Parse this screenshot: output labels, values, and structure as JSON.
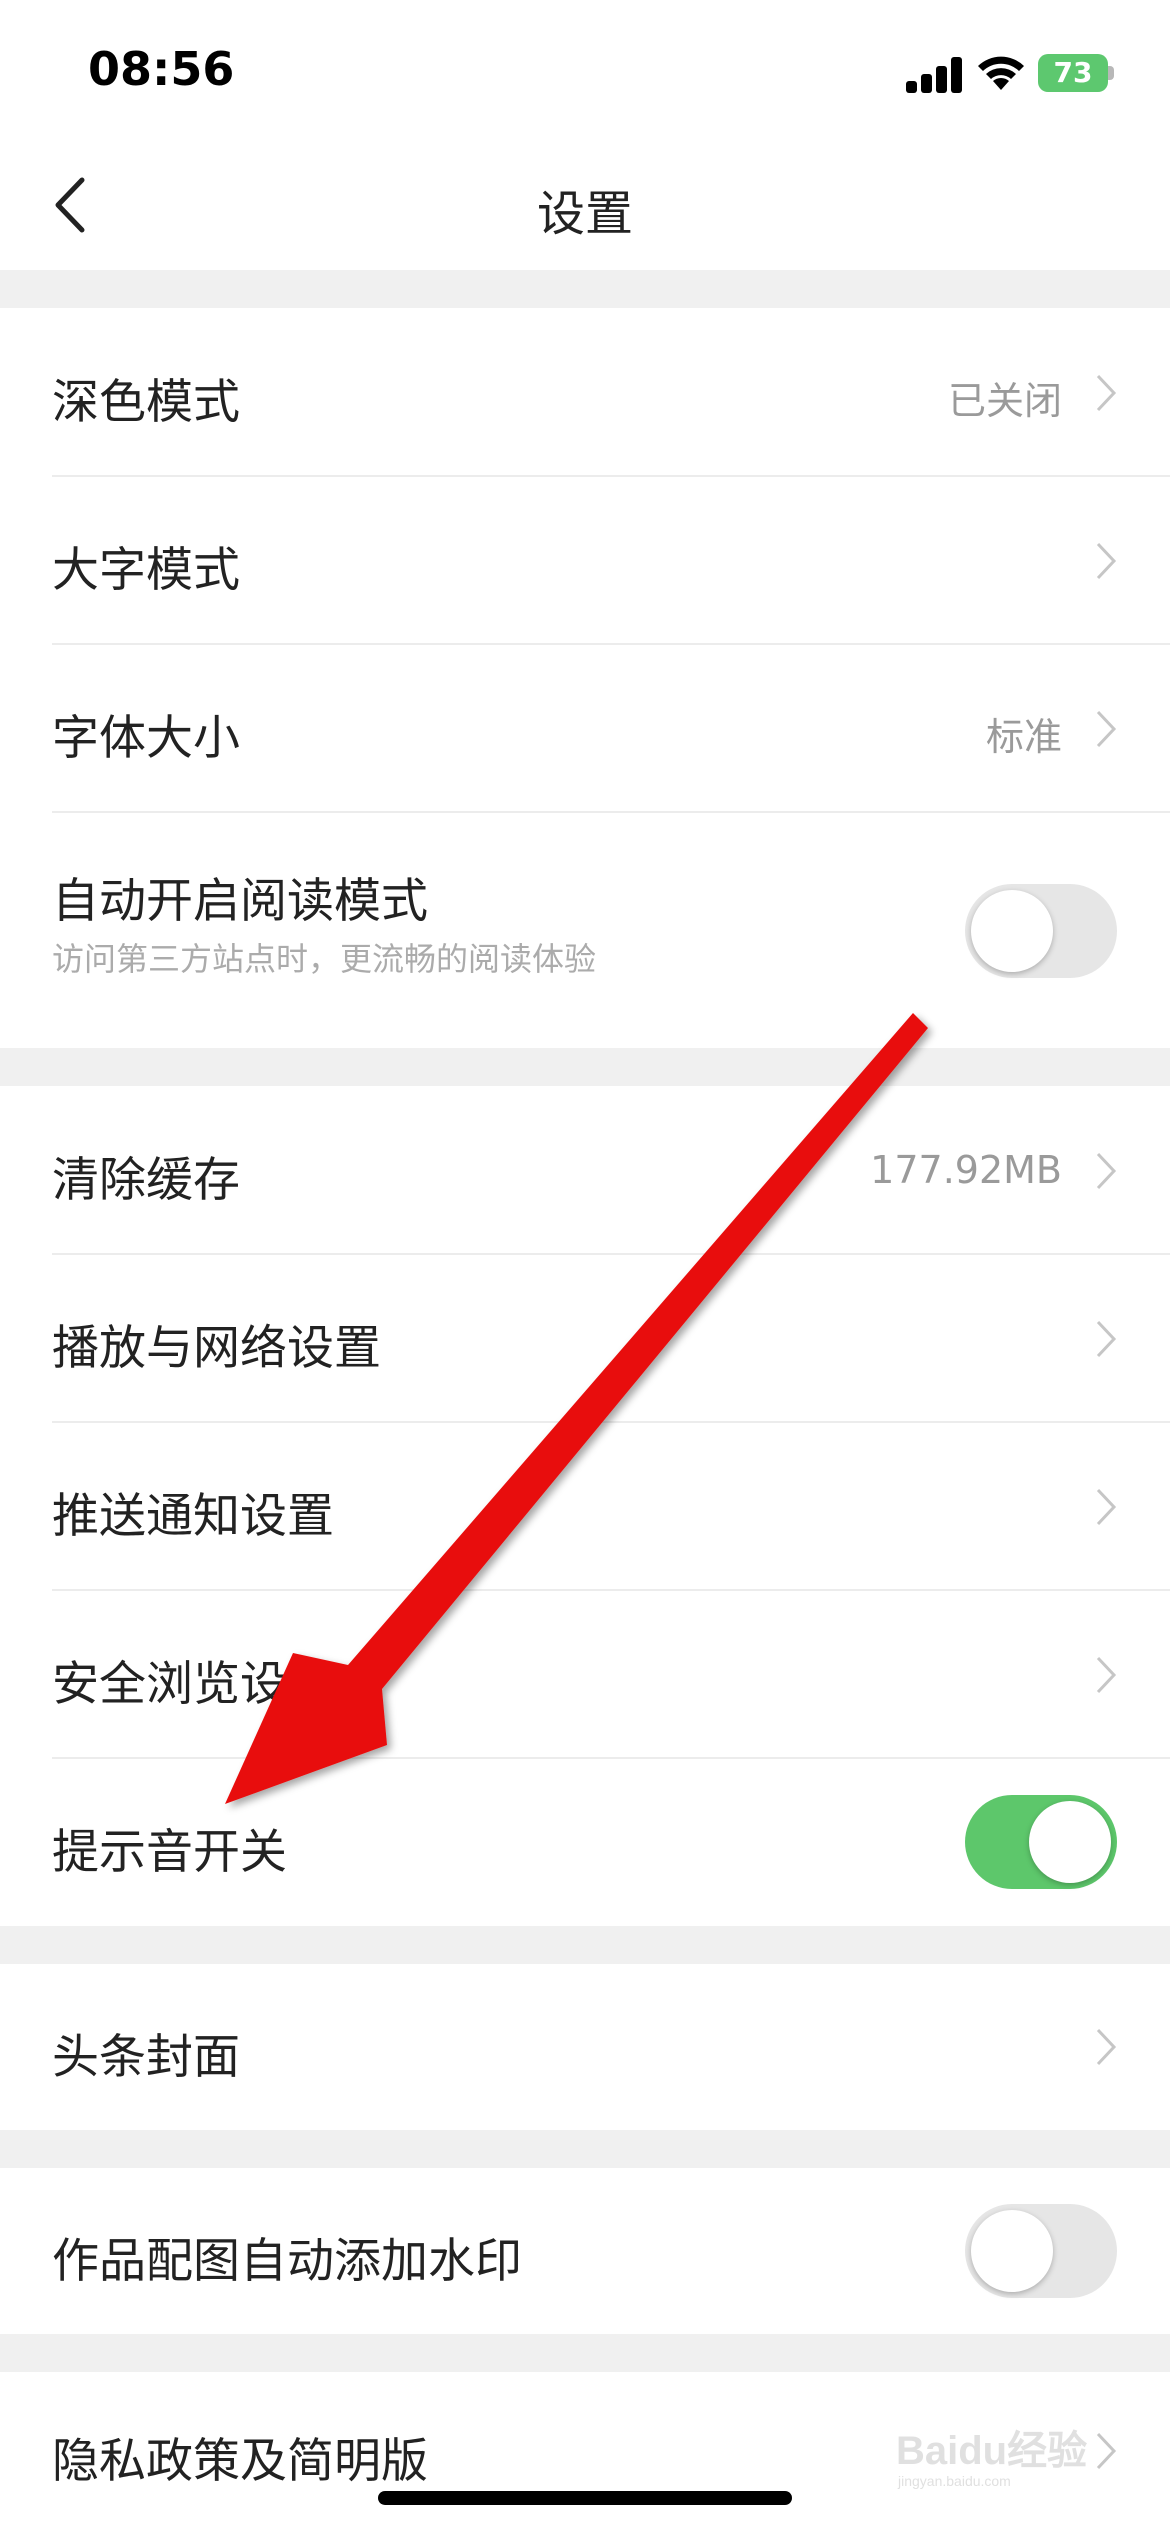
{
  "status_bar": {
    "time": "08:56",
    "battery": "73",
    "icons": [
      "cellular-signal-icon",
      "wifi-icon",
      "battery-charging-icon"
    ]
  },
  "nav": {
    "title": "设置",
    "back_icon": "chevron-left-icon"
  },
  "groups": [
    {
      "rows": [
        {
          "label": "深色模式",
          "value": "已关闭",
          "control": "chevron"
        },
        {
          "label": "大字模式",
          "value": "",
          "control": "chevron"
        },
        {
          "label": "字体大小",
          "value": "标准",
          "control": "chevron"
        },
        {
          "label": "自动开启阅读模式",
          "subtitle": "访问第三方站点时，更流畅的阅读体验",
          "control": "toggle",
          "toggle_on": false
        }
      ]
    },
    {
      "rows": [
        {
          "label": "清除缓存",
          "value": "177.92MB",
          "control": "chevron"
        },
        {
          "label": "播放与网络设置",
          "value": "",
          "control": "chevron"
        },
        {
          "label": "推送通知设置",
          "value": "",
          "control": "chevron"
        },
        {
          "label": "安全浏览设置",
          "value": "",
          "control": "chevron"
        },
        {
          "label": "提示音开关",
          "control": "toggle",
          "toggle_on": true
        }
      ]
    },
    {
      "rows": [
        {
          "label": "头条封面",
          "value": "",
          "control": "chevron"
        }
      ]
    },
    {
      "rows": [
        {
          "label": "作品配图自动添加水印",
          "control": "toggle",
          "toggle_on": false
        }
      ]
    },
    {
      "rows": [
        {
          "label": "隐私政策及简明版",
          "value": "",
          "control": "chevron"
        }
      ]
    }
  ],
  "annotation": {
    "type": "red-arrow-icon",
    "color": "#e8100f",
    "points_to": "提示音开关"
  },
  "watermark": {
    "text": "Baidu经验",
    "sub": "jingyan.baidu.com"
  },
  "colors": {
    "toggle_on": "#5dc76b",
    "toggle_off": "#e6e6e6",
    "battery": "#5dc86f",
    "arrow": "#e8100f"
  }
}
